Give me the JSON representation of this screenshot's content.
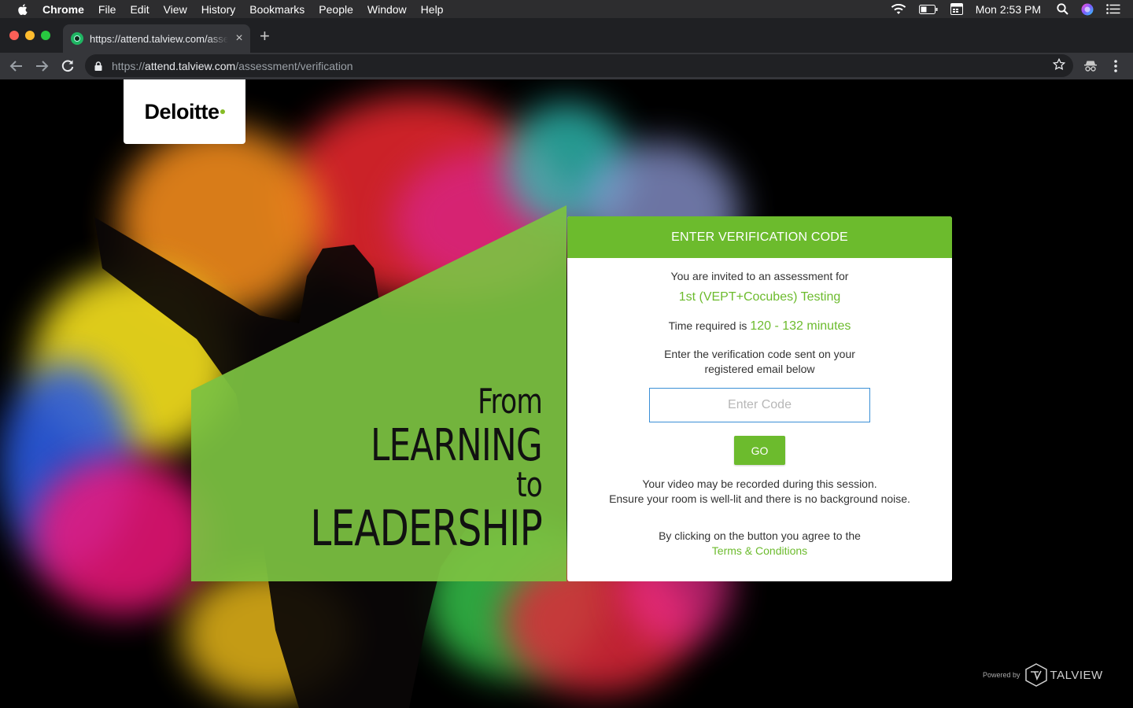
{
  "menubar": {
    "app": "Chrome",
    "items": [
      "File",
      "Edit",
      "View",
      "History",
      "Bookmarks",
      "People",
      "Window",
      "Help"
    ],
    "clock": "Mon 2:53 PM"
  },
  "browser": {
    "tab_title": "https://attend.talview.com/assessment/verification",
    "url_scheme": "https://",
    "url_host": "attend.talview.com",
    "url_path": "/assessment/verification",
    "close_glyph": "×",
    "newtab_glyph": "+"
  },
  "page": {
    "logo": "Deloitte",
    "logo_dot_color": "#86bc25",
    "tagline": {
      "from": "From",
      "learning": "LEARNING",
      "to": "to",
      "leadership": "LEADERSHIP"
    },
    "card": {
      "header": "ENTER VERIFICATION CODE",
      "invited": "You are invited to an assessment for",
      "assessment_name": "1st (VEPT+Cocubes) Testing",
      "time_prefix": "Time required is",
      "time_value": "120 - 132 minutes",
      "enter_line1": "Enter the verification code sent on your",
      "enter_line2": "registered email below",
      "code_placeholder": "Enter Code",
      "code_value": "",
      "go_label": "GO",
      "record_line1": "Your video may be recorded during this session.",
      "record_line2": "Ensure your room is well-lit and there is no background noise.",
      "agree_line": "By clicking on the button you agree to the",
      "terms": "Terms & Conditions"
    },
    "powered_by": "Powered by",
    "powered_brand": "TALVIEW",
    "accent_color": "#6cbb2d"
  }
}
